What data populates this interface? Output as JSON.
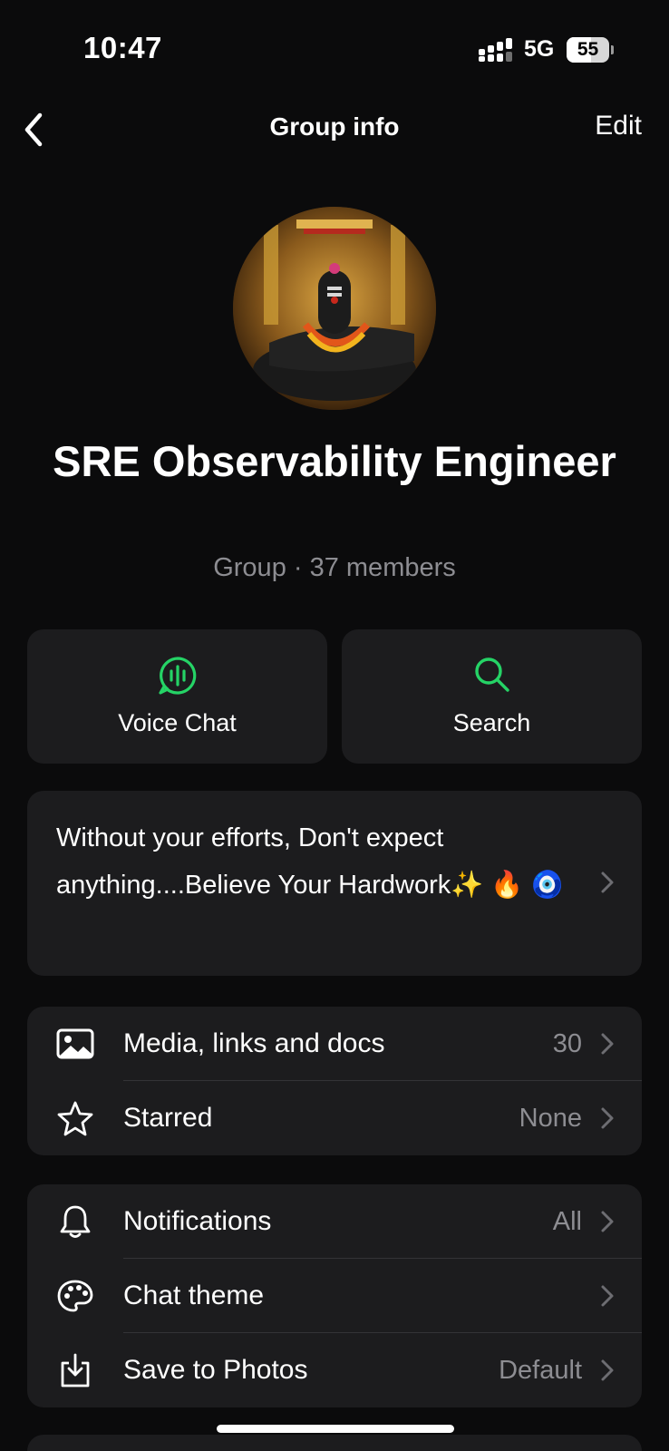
{
  "status_bar": {
    "time": "10:47",
    "network": "5G",
    "battery": "55"
  },
  "nav": {
    "title": "Group info",
    "edit_label": "Edit"
  },
  "group": {
    "name": "SRE Observability Engineer",
    "meta": "Group · 37 members"
  },
  "actions": [
    {
      "label": "Voice Chat",
      "icon": "voice-chat-icon"
    },
    {
      "label": "Search",
      "icon": "search-icon"
    }
  ],
  "description": {
    "text": "Without your efforts, Don't expect anything....Believe Your Hardwork✨ 🔥 🧿"
  },
  "section1": [
    {
      "label": "Media, links and docs",
      "value": "30",
      "icon": "image-icon"
    },
    {
      "label": "Starred",
      "value": "None",
      "icon": "star-icon"
    }
  ],
  "section2": [
    {
      "label": "Notifications",
      "value": "All",
      "icon": "bell-icon"
    },
    {
      "label": "Chat theme",
      "value": "",
      "icon": "palette-icon"
    },
    {
      "label": "Save to Photos",
      "value": "Default",
      "icon": "download-icon"
    }
  ],
  "colors": {
    "background": "#0b0b0c",
    "card": "#1c1c1e",
    "accent": "#25d366",
    "secondary_text": "#8d8d92"
  }
}
